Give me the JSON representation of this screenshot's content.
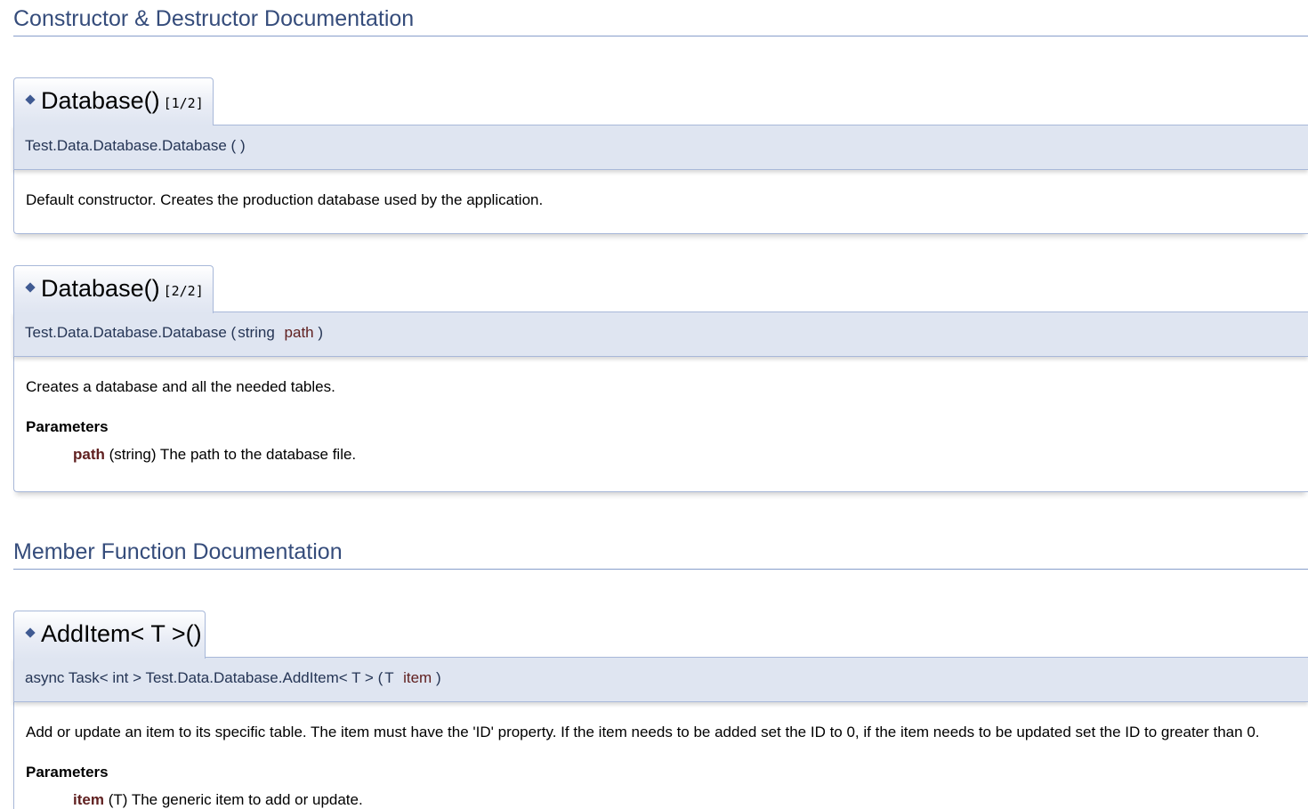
{
  "sections": {
    "constructors_title": "Constructor & Destructor Documentation",
    "members_title": "Member Function Documentation"
  },
  "ctor1": {
    "name": "Database()",
    "overload": "[1/2]",
    "proto_prefix": "Test.Data.Database.Database",
    "proto_open": "(",
    "proto_close": ")",
    "description": "Default constructor. Creates the production database used by the application."
  },
  "ctor2": {
    "name": "Database()",
    "overload": "[2/2]",
    "proto_prefix": "Test.Data.Database.Database",
    "proto_open": "(",
    "param_type": "string",
    "param_name": "path",
    "proto_close": ")",
    "description": "Creates a database and all the needed tables.",
    "params_title": "Parameters",
    "param_doc_name": "path",
    "param_doc_text": "(string) The path to the database file."
  },
  "additem": {
    "name": "AddItem< T >()",
    "proto_prefix": "async Task< int > Test.Data.Database.AddItem< T >",
    "proto_open": "(",
    "param_type": "T",
    "param_name": "item",
    "proto_close": ")",
    "description": "Add or update an item to its specific table. The item must have the 'ID' property. If the item needs to be added set the ID to 0, if the item needs to be updated set the ID to greater than 0.",
    "params_title": "Parameters",
    "param_doc_name": "item",
    "param_doc_text": "(T) The generic item to add or update."
  },
  "icons": {
    "bullet": "diamond-bullet-icon"
  },
  "colors": {
    "heading": "#354C7B",
    "proto_bg": "#DFE5F1",
    "border": "#A8B8D9",
    "param_name": "#602020",
    "bullet": "#3F5A92"
  }
}
